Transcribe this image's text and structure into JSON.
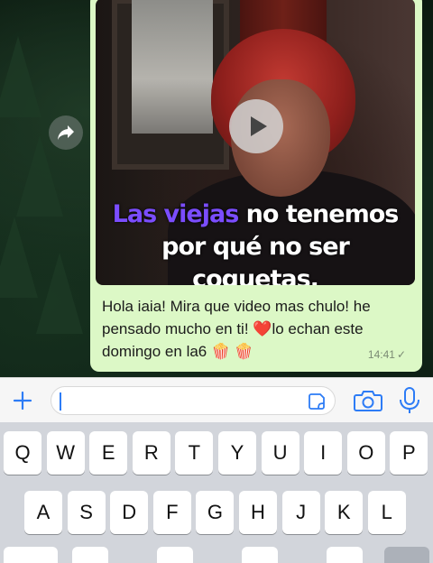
{
  "colors": {
    "bubble": "#dcf8c6",
    "caption_highlight": "#7b4dff",
    "accent": "#2d7cf6"
  },
  "video": {
    "caption_highlight": "Las viejas",
    "caption_line1_rest": " no tenemos",
    "caption_line2": "por qué no ser coquetas.",
    "play_icon": "play-icon"
  },
  "message": {
    "text_part1": "Hola iaia! Mira que video mas chulo! he pensado mucho en ti! ",
    "heart": "❤️",
    "text_part2": "lo echan este domingo en la6 ",
    "emojis": "🍿 🍿",
    "time": "14:41",
    "status_icon": "single-check-icon"
  },
  "input": {
    "plus_icon": "plus-icon",
    "sticker_icon": "sticker-icon",
    "camera_icon": "camera-icon",
    "mic_icon": "microphone-icon"
  },
  "keyboard": {
    "row1": [
      "Q",
      "W",
      "E",
      "R",
      "T",
      "Y",
      "U",
      "I",
      "O",
      "P"
    ],
    "row2": [
      "A",
      "S",
      "D",
      "F",
      "G",
      "H",
      "J",
      "K",
      "L"
    ]
  },
  "forward_icon": "forward-icon"
}
